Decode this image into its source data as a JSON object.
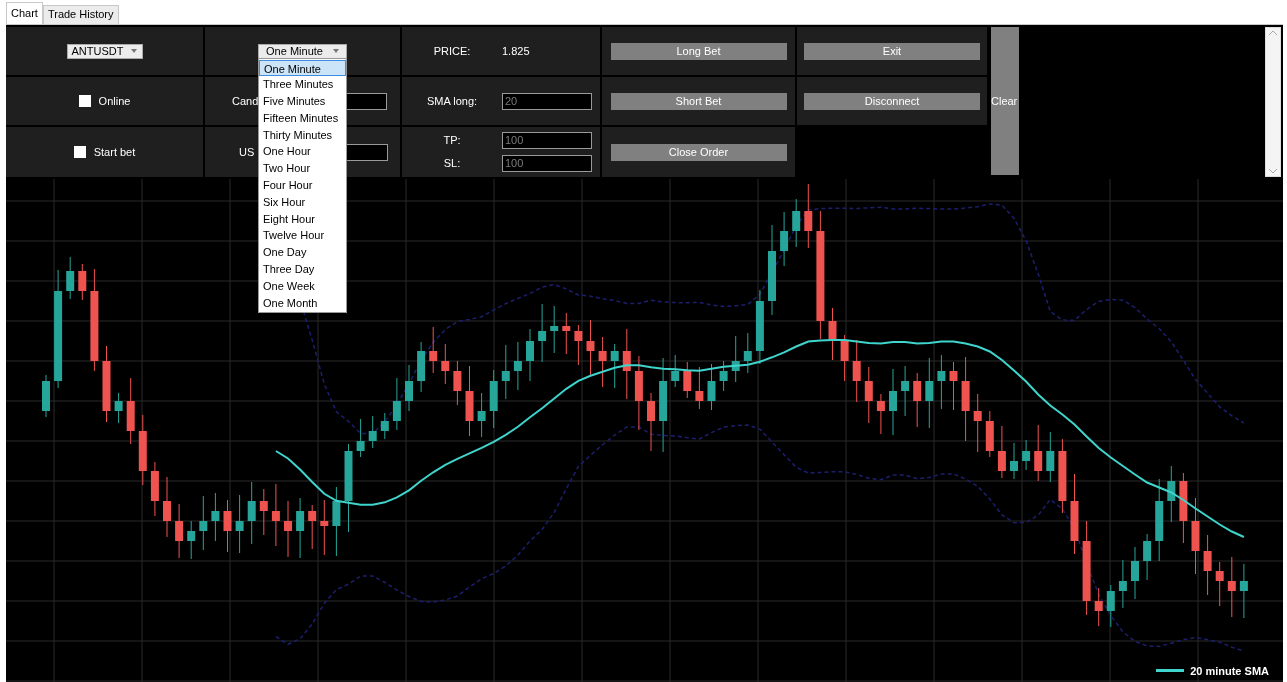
{
  "tabs": [
    {
      "label": "Chart",
      "selected": true
    },
    {
      "label": "Trade History",
      "selected": false
    }
  ],
  "symbol_select": {
    "value": "ANTUSDT"
  },
  "interval_select": {
    "value": "One Minute",
    "expanded": true,
    "options": [
      {
        "label": "One Minute",
        "selected": true
      },
      {
        "label": "Three Minutes",
        "selected": false
      },
      {
        "label": "Five Minutes",
        "selected": false
      },
      {
        "label": "Fifteen Minutes",
        "selected": false
      },
      {
        "label": "Thirty Minutes",
        "selected": false
      },
      {
        "label": "One Hour",
        "selected": false
      },
      {
        "label": "Two Hour",
        "selected": false
      },
      {
        "label": "Four Hour",
        "selected": false
      },
      {
        "label": "Six Hour",
        "selected": false
      },
      {
        "label": "Eight Hour",
        "selected": false
      },
      {
        "label": "Twelve Hour",
        "selected": false
      },
      {
        "label": "One Day",
        "selected": false
      },
      {
        "label": "Three Day",
        "selected": false
      },
      {
        "label": "One Week",
        "selected": false
      },
      {
        "label": "One Month",
        "selected": false
      }
    ]
  },
  "checkboxes": [
    {
      "label": "Online",
      "checked": false
    },
    {
      "label": "Start bet",
      "checked": false
    }
  ],
  "left_fields": [
    {
      "label": "Cand"
    },
    {
      "label": "US"
    }
  ],
  "price": {
    "label": "PRICE:",
    "value": "1.825"
  },
  "sma_long": {
    "label": "SMA long:",
    "value": "20"
  },
  "tp": {
    "label": "TP:",
    "value": "100"
  },
  "sl": {
    "label": "SL:",
    "value": "100"
  },
  "buttons": {
    "long_bet": "Long Bet",
    "short_bet": "Short Bet",
    "close_order": "Close Order",
    "exit": "Exit",
    "disconnect": "Disconnect",
    "clear": "Clear"
  },
  "chart": {
    "legend": "20 minute SMA"
  }
}
